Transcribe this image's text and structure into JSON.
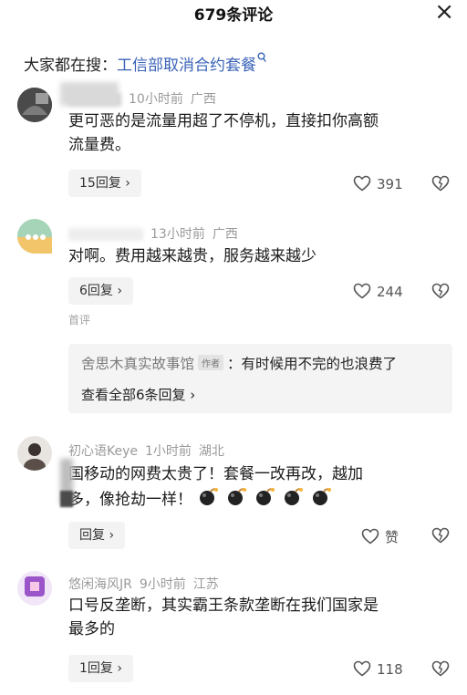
{
  "header": {
    "title": "679条评论",
    "close_label": "×"
  },
  "search": {
    "prefix": "大家都在搜：",
    "topic": "工信部取消合约套餐"
  },
  "pinned_label": "首评",
  "comments": [
    {
      "time": "10小时前",
      "region": "广西",
      "text_lines": [
        "更可恶的是流量用超了不停机，直接扣你高额",
        "流量费。"
      ],
      "reply_label": "15回复 ›",
      "likes": "391"
    },
    {
      "time": "13小时前",
      "region": "广西",
      "text_lines": [
        "对啊。费用越来越贵，服务越来越少"
      ],
      "reply_label": "6回复 ›",
      "likes": "244"
    },
    {
      "name": "初心语Keye",
      "time": "1小时前",
      "region": "湖北",
      "text_lines": [
        "国移动的网费太贵了！套餐一改再改，越加",
        "多，像抢劫一样！"
      ],
      "reply_label": "回复 ›",
      "likes": "赞"
    },
    {
      "name": "悠闲海风JR",
      "time": "9小时前",
      "region": "江苏",
      "text_lines": [
        "口号反垄断，其实霸王条款垄断在我们国家是",
        "最多的"
      ],
      "reply_label": "1回复 ›",
      "likes": "118"
    }
  ],
  "author_reply": {
    "name": "舍思木真实故事馆",
    "tag": "作者",
    "text": "：有时候用不完的也浪费了",
    "view_all": "查看全部6条回复 ›"
  },
  "colors": {
    "link": "#3a63b8",
    "meta": "#9a9a9a",
    "reply_bg": "#f3f3f3"
  }
}
